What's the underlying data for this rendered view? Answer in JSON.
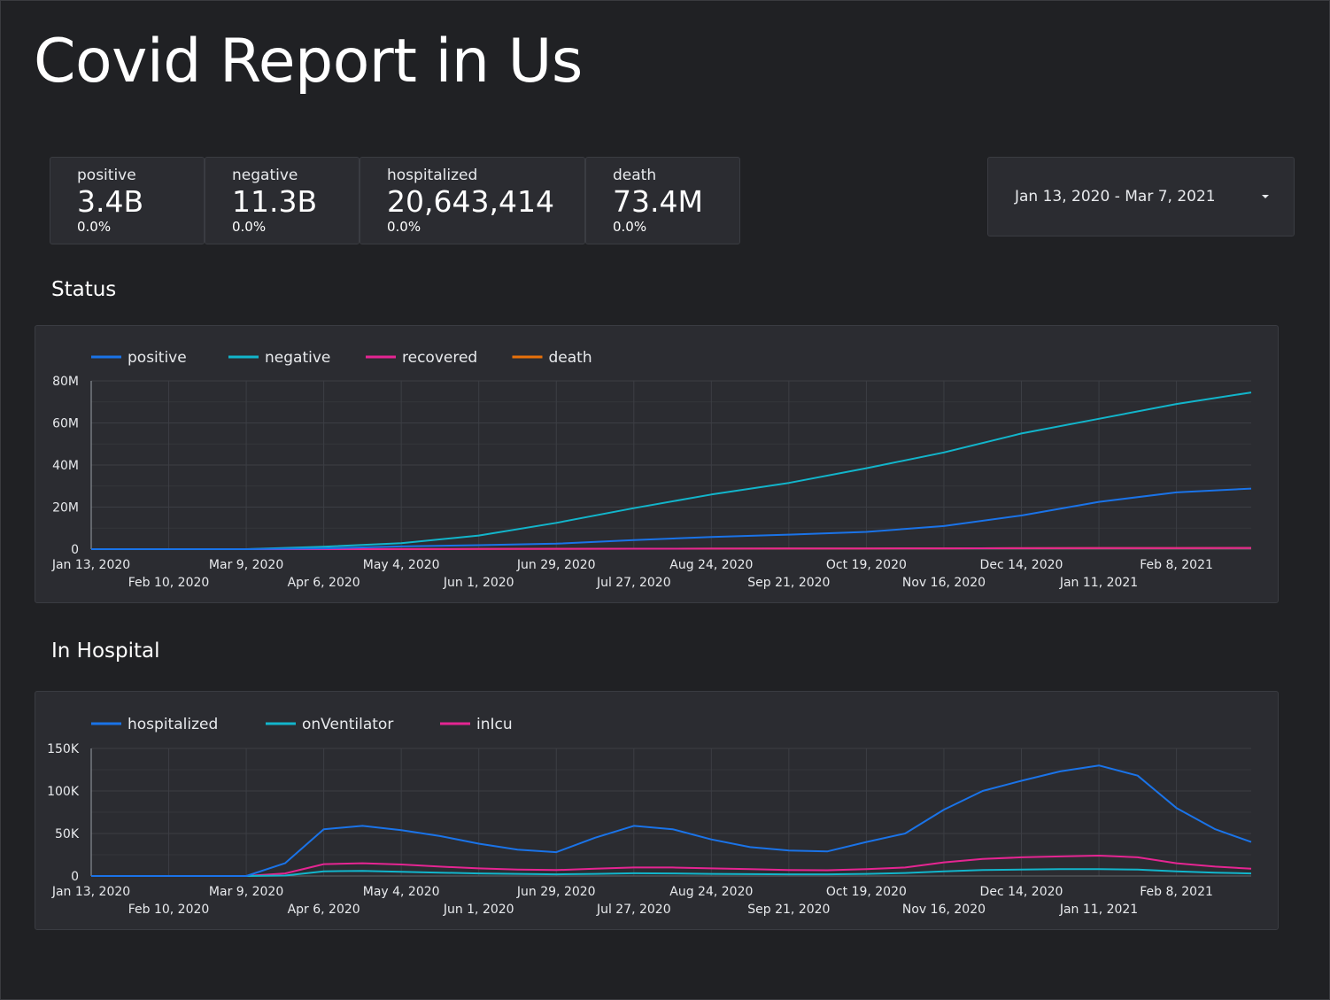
{
  "report": {
    "title": "Covid Report in Us"
  },
  "scorecards": [
    {
      "label": "positive",
      "value": "3.4B",
      "delta": "0.0%"
    },
    {
      "label": "negative",
      "value": "11.3B",
      "delta": "0.0%"
    },
    {
      "label": "hospitalized",
      "value": "20,643,414",
      "delta": "0.0%"
    },
    {
      "label": "death",
      "value": "73.4M",
      "delta": "0.0%"
    }
  ],
  "date_range": {
    "value": "Jan 13, 2020 - Mar 7, 2021"
  },
  "sections": {
    "status_title": "Status",
    "hospital_title": "In Hospital"
  },
  "colors": {
    "blue": "#1a73e8",
    "teal": "#12b5cb",
    "pink": "#e52592",
    "orange": "#e8710a",
    "background": "#202124",
    "card": "#2b2c31"
  },
  "chart_data": [
    {
      "type": "line",
      "title": "Status",
      "x_ticks_row1": [
        "Jan 13, 2020",
        "Mar 9, 2020",
        "May 4, 2020",
        "Jun 29, 2020",
        "Aug 24, 2020",
        "Oct 19, 2020",
        "Dec 14, 2020",
        "Feb 8, 2021"
      ],
      "x_ticks_row2": [
        "Feb 10, 2020",
        "Apr 6, 2020",
        "Jun 1, 2020",
        "Jul 27, 2020",
        "Sep 21, 2020",
        "Nov 16, 2020",
        "Jan 11, 2021"
      ],
      "y_ticks": [
        "0",
        "20M",
        "40M",
        "60M",
        "80M"
      ],
      "ylim": [
        0,
        80000000
      ],
      "legend_position": "top-left",
      "grid": true,
      "x": [
        "2020-01-13",
        "2020-02-10",
        "2020-03-09",
        "2020-04-06",
        "2020-05-04",
        "2020-06-01",
        "2020-06-29",
        "2020-07-27",
        "2020-08-24",
        "2020-09-21",
        "2020-10-19",
        "2020-11-16",
        "2020-12-14",
        "2021-01-11",
        "2021-02-08",
        "2021-03-07"
      ],
      "series": [
        {
          "name": "positive",
          "color": "#1a73e8",
          "values": [
            0,
            0,
            0,
            400000,
            1300000,
            1900000,
            2600000,
            4300000,
            5800000,
            6900000,
            8200000,
            11000000,
            16000000,
            22500000,
            27000000,
            28800000
          ]
        },
        {
          "name": "negative",
          "color": "#12b5cb",
          "values": [
            0,
            0,
            0,
            1200000,
            2800000,
            6500000,
            12500000,
            19500000,
            26000000,
            31500000,
            38500000,
            46000000,
            55000000,
            62000000,
            69000000,
            74500000
          ]
        },
        {
          "name": "recovered",
          "color": "#e52592",
          "values": [
            0,
            0,
            0,
            0,
            50000,
            100000,
            150000,
            200000,
            250000,
            300000,
            350000,
            400000,
            450000,
            500000,
            550000,
            600000
          ]
        },
        {
          "name": "death",
          "color": "#e8710a",
          "values": [
            0,
            0,
            0,
            10000,
            50000,
            100000,
            150000,
            200000,
            250000,
            300000,
            350000,
            400000,
            450000,
            500000,
            550000,
            600000
          ]
        }
      ]
    },
    {
      "type": "line",
      "title": "In Hospital",
      "x_ticks_row1": [
        "Jan 13, 2020",
        "Mar 9, 2020",
        "May 4, 2020",
        "Jun 29, 2020",
        "Aug 24, 2020",
        "Oct 19, 2020",
        "Dec 14, 2020",
        "Feb 8, 2021"
      ],
      "x_ticks_row2": [
        "Feb 10, 2020",
        "Apr 6, 2020",
        "Jun 1, 2020",
        "Jul 27, 2020",
        "Sep 21, 2020",
        "Nov 16, 2020",
        "Jan 11, 2021"
      ],
      "y_ticks": [
        "0",
        "50K",
        "100K",
        "150K"
      ],
      "ylim": [
        0,
        150000
      ],
      "legend_position": "top-left",
      "grid": true,
      "x": [
        "2020-01-13",
        "2020-02-10",
        "2020-03-09",
        "2020-03-23",
        "2020-04-06",
        "2020-04-20",
        "2020-05-04",
        "2020-05-18",
        "2020-06-01",
        "2020-06-15",
        "2020-06-29",
        "2020-07-13",
        "2020-07-27",
        "2020-08-10",
        "2020-08-24",
        "2020-09-07",
        "2020-09-21",
        "2020-10-05",
        "2020-10-19",
        "2020-11-02",
        "2020-11-16",
        "2020-11-30",
        "2020-12-14",
        "2020-12-28",
        "2021-01-11",
        "2021-01-25",
        "2021-02-08",
        "2021-02-22",
        "2021-03-07"
      ],
      "series": [
        {
          "name": "hospitalized",
          "color": "#1a73e8",
          "values": [
            0,
            0,
            0,
            15000,
            55000,
            59000,
            54000,
            47000,
            38000,
            31000,
            28000,
            45000,
            59000,
            55000,
            43000,
            34000,
            30000,
            29000,
            40000,
            50000,
            78000,
            100000,
            112000,
            123000,
            130000,
            118000,
            80000,
            55000,
            40000
          ]
        },
        {
          "name": "onVentilator",
          "color": "#12b5cb",
          "values": [
            0,
            0,
            0,
            500,
            5500,
            6000,
            5000,
            4000,
            3000,
            2500,
            2000,
            2500,
            3200,
            3000,
            2500,
            2200,
            2000,
            2000,
            2500,
            3500,
            5500,
            7000,
            7500,
            8000,
            8000,
            7500,
            5500,
            4000,
            3000
          ]
        },
        {
          "name": "inIcu",
          "color": "#e52592",
          "values": [
            0,
            0,
            0,
            3000,
            14000,
            15000,
            13500,
            11000,
            9000,
            7500,
            7000,
            8500,
            10000,
            10000,
            9000,
            8000,
            7000,
            6800,
            8000,
            10000,
            16000,
            20000,
            22000,
            23000,
            24000,
            22000,
            15000,
            11000,
            8500
          ]
        }
      ]
    }
  ]
}
